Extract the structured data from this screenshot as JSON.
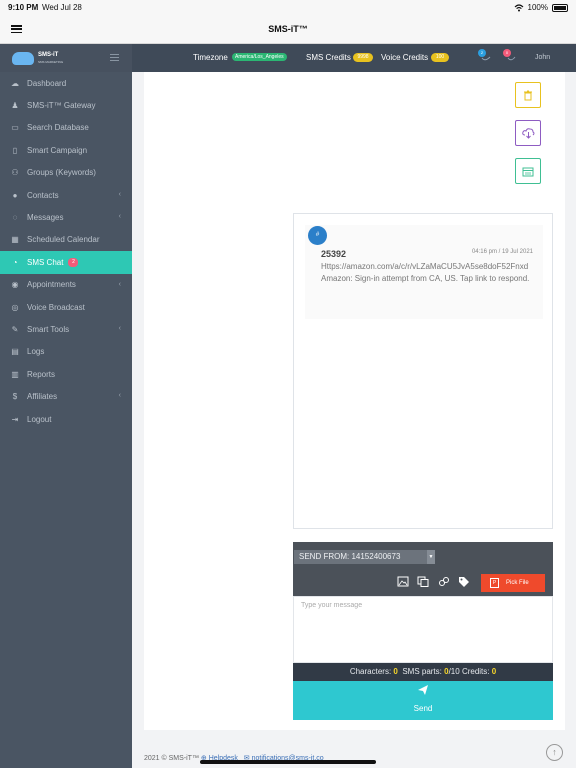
{
  "status_bar": {
    "time": "9:10 PM",
    "date": "Wed Jul 28",
    "battery": "100%"
  },
  "app": {
    "title": "SMS-iT™"
  },
  "topbar": {
    "logo": "SMS-iT",
    "logo_sub": "SMS MARKETING",
    "timezone_label": "Timezone",
    "timezone_value": "America/Los_Angeles",
    "sms_credits_label": "SMS Credits",
    "sms_credits_value": "9998",
    "voice_credits_label": "Voice Credits",
    "voice_credits_value": "100",
    "messages_count": "2",
    "notifications_count": "0",
    "user": "John",
    "colors": {
      "bar": "#3f4a58",
      "timezone_badge": "#2bb673",
      "credit_badge": "#e8c21f"
    }
  },
  "sidebar": {
    "items": [
      {
        "label": "Dashboard",
        "icon": "cloud-icon",
        "chevron": ""
      },
      {
        "label": "SMS-iT™ Gateway",
        "icon": "android-icon",
        "chevron": ""
      },
      {
        "label": "Search Database",
        "icon": "monitor-icon",
        "chevron": ""
      },
      {
        "label": "Smart Campaign",
        "icon": "phone-icon",
        "chevron": ""
      },
      {
        "label": "Groups (Keywords)",
        "icon": "users-icon",
        "chevron": ""
      },
      {
        "label": "Contacts",
        "icon": "user-icon",
        "chevron": "‹"
      },
      {
        "label": "Messages",
        "icon": "comment-icon",
        "chevron": "‹"
      },
      {
        "label": "Scheduled Calendar",
        "icon": "calendar-icon",
        "chevron": ""
      },
      {
        "label": "SMS Chat",
        "icon": "chat-icon",
        "chevron": "",
        "badge": "2",
        "active": true
      },
      {
        "label": "Appointments",
        "icon": "bullhorn-icon",
        "chevron": "‹"
      },
      {
        "label": "Voice Broadcast",
        "icon": "broadcast-icon",
        "chevron": ""
      },
      {
        "label": "Smart Tools",
        "icon": "wrench-icon",
        "chevron": "‹"
      },
      {
        "label": "Logs",
        "icon": "file-icon",
        "chevron": ""
      },
      {
        "label": "Reports",
        "icon": "bar-chart-icon",
        "chevron": ""
      },
      {
        "label": "Affiliates",
        "icon": "dollar-icon",
        "chevron": "‹"
      },
      {
        "label": "Logout",
        "icon": "logout-icon",
        "chevron": ""
      }
    ],
    "colors": {
      "bg": "#4a5563",
      "active": "#2ec8b4"
    }
  },
  "actions": {
    "delete_icon": "trash-icon",
    "download_icon": "cloud-download-icon",
    "calendar_icon": "calendar-icon",
    "colors": {
      "delete": "#e8c21f",
      "download": "#8e5cc2",
      "calendar": "#3fbf93"
    }
  },
  "conversation": {
    "messages": [
      {
        "avatar": "#",
        "sender": "25392",
        "time": "04:16 pm / 19 Jul 2021",
        "text": "Https://amazon.com/a/c/r/vLZaMaCU5JvA5se8doF52Fnxd Amazon: Sign-in attempt from CA, US. Tap link to respond."
      }
    ]
  },
  "compose": {
    "send_from": "SEND FROM: 14152400673",
    "pick_file": "Pick File",
    "placeholder": "Type your message",
    "characters_label": "Characters:",
    "characters_value": "0",
    "sms_parts_label": "SMS parts:",
    "sms_parts_value": "0",
    "sms_parts_max": "/10",
    "credits_label": "Credits:",
    "credits_value": "0",
    "send_label": "Send",
    "colors": {
      "send": "#2ec8d0",
      "pick_file": "#ef4a2c",
      "counter": "#313a46"
    }
  },
  "footer": {
    "copyright": "2021 © SMS-iT™",
    "helpdesk": "Helpdesk",
    "email": "notifications@sms-it.co"
  }
}
